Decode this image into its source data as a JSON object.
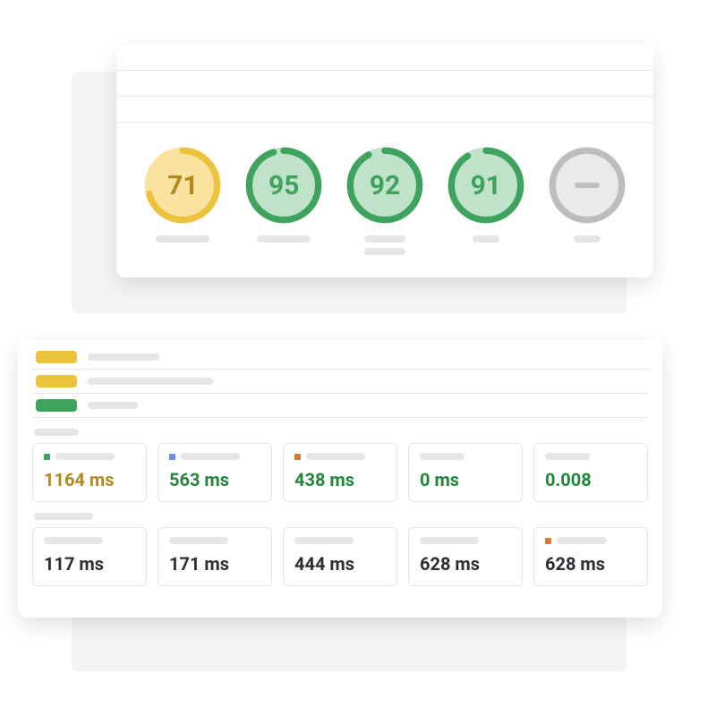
{
  "gauges": [
    {
      "value": "71",
      "pct": 71,
      "style": "yellow"
    },
    {
      "value": "95",
      "pct": 95,
      "style": "green"
    },
    {
      "value": "92",
      "pct": 92,
      "style": "green"
    },
    {
      "value": "91",
      "pct": 91,
      "style": "green"
    },
    {
      "value": "—",
      "pct": 0,
      "style": "grey"
    }
  ],
  "status_rows": [
    {
      "color": "yellow",
      "bar_w": "w80"
    },
    {
      "color": "yellow",
      "bar_w": "w140"
    },
    {
      "color": "green",
      "bar_w": "w56"
    }
  ],
  "metrics_top": [
    {
      "dot": "green",
      "value": "1164 ms",
      "color": "yellow"
    },
    {
      "dot": "blue",
      "value": "563 ms",
      "color": "green"
    },
    {
      "dot": "orange",
      "value": "438 ms",
      "color": "green"
    },
    {
      "dot": "none",
      "value": "0 ms",
      "color": "green"
    },
    {
      "dot": "none",
      "value": "0.008",
      "color": "green"
    }
  ],
  "metrics_bottom": [
    {
      "dot": "none",
      "value": "117 ms",
      "color": "dark"
    },
    {
      "dot": "none",
      "value": "171 ms",
      "color": "dark"
    },
    {
      "dot": "none",
      "value": "444 ms",
      "color": "dark"
    },
    {
      "dot": "none",
      "value": "628 ms",
      "color": "dark"
    },
    {
      "dot": "orange",
      "value": "628 ms",
      "color": "dark"
    }
  ]
}
